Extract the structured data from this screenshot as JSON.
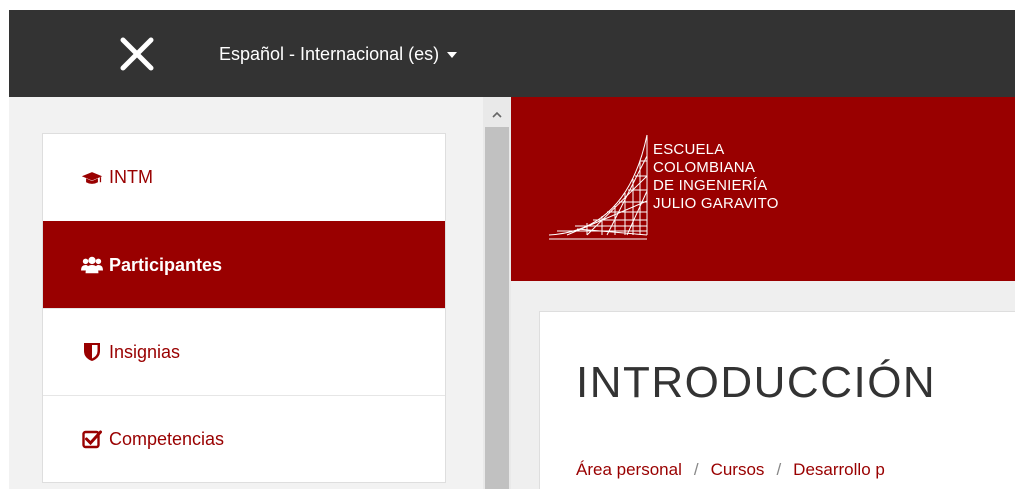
{
  "navbar": {
    "close_icon": "close-icon",
    "language_label": "Español - Internacional (es)",
    "language_caret_icon": "caret-down-icon"
  },
  "drawer": {
    "items": [
      {
        "label": "INTM",
        "icon": "graduation-cap-icon",
        "active": false
      },
      {
        "label": "Participantes",
        "icon": "users-icon",
        "active": true
      },
      {
        "label": "Insignias",
        "icon": "shield-icon",
        "active": false
      },
      {
        "label": "Competencias",
        "icon": "check-square-icon",
        "active": false
      }
    ]
  },
  "logo": {
    "line1": "ESCUELA",
    "line2": "COLOMBIANA",
    "line3": "DE INGENIERÍA",
    "line4": "JULIO GARAVITO"
  },
  "page": {
    "title": "INTRODUCCIÓN",
    "breadcrumb": [
      "Área personal",
      "Cursos",
      "Desarrollo p"
    ]
  },
  "colors": {
    "brand": "#990000",
    "navbar": "#333333"
  }
}
